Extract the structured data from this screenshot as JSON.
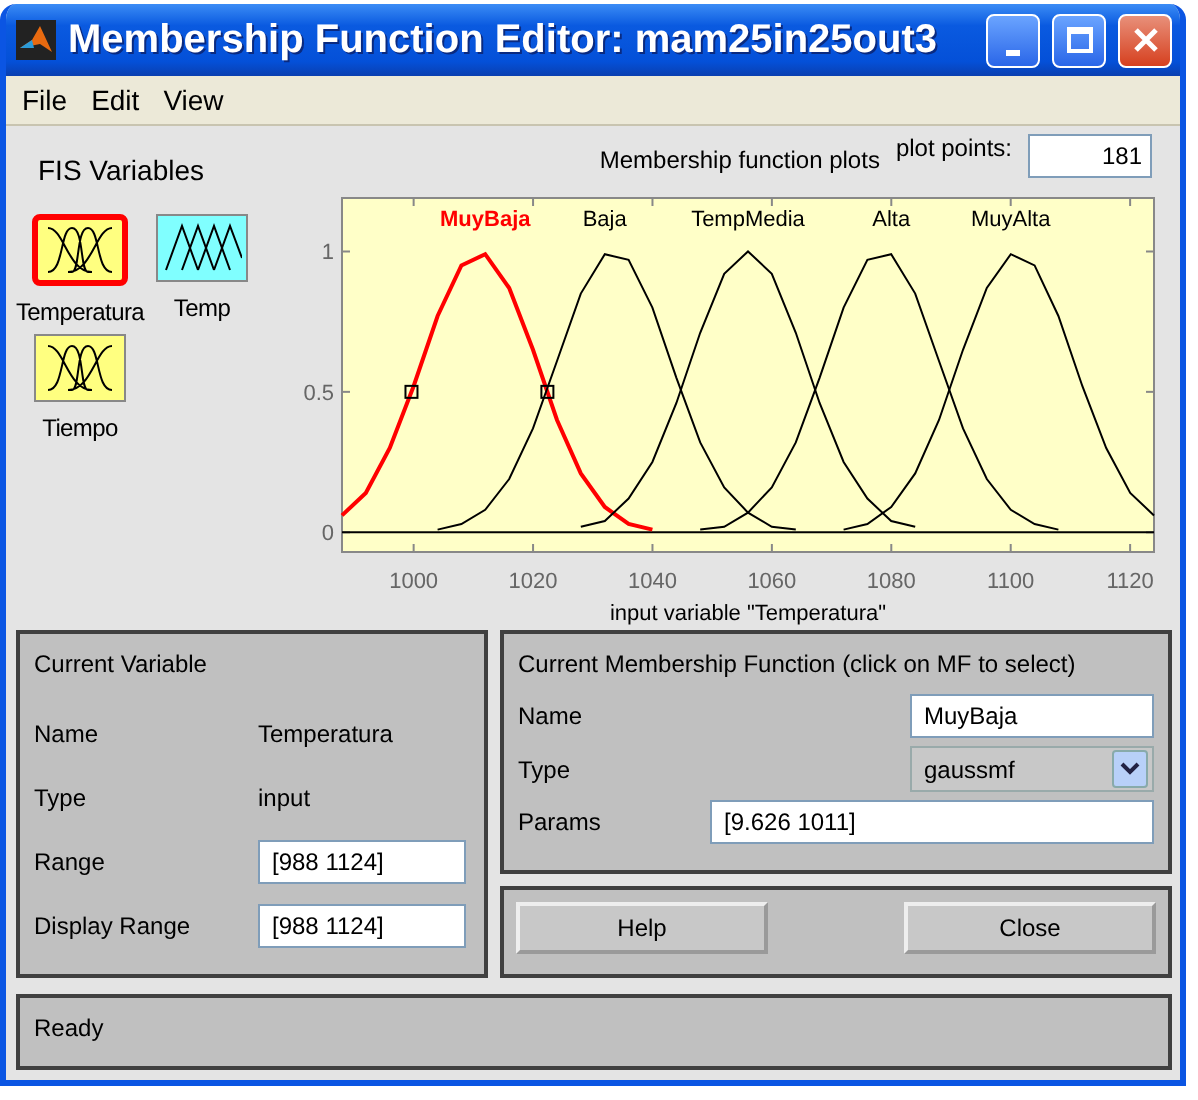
{
  "window": {
    "title": "Membership Function Editor: mam25in25out3"
  },
  "menu": [
    "File",
    "Edit",
    "View"
  ],
  "fis_variables": {
    "title": "FIS Variables",
    "items": [
      {
        "name": "Temperatura",
        "kind": "input",
        "color": "#ffff80",
        "selected": true
      },
      {
        "name": "Temp",
        "kind": "output",
        "color": "#80ffff",
        "selected": false
      },
      {
        "name": "Tiempo",
        "kind": "input",
        "color": "#ffff80",
        "selected": false
      }
    ]
  },
  "plot_header": {
    "title": "Membership function plots",
    "plot_points_label": "plot points:",
    "plot_points": "181"
  },
  "chart_data": {
    "type": "line",
    "xlabel": "input variable \"Temperatura\"",
    "xlim": [
      988,
      1124
    ],
    "ylim": [
      -0.07,
      1.19
    ],
    "xticks": [
      1000,
      1020,
      1040,
      1060,
      1080,
      1100,
      1120
    ],
    "yticks": [
      0,
      0.5,
      1
    ],
    "x": [
      988,
      992,
      996,
      1000,
      1004,
      1008,
      1012,
      1016,
      1020,
      1024,
      1028,
      1032,
      1036,
      1040,
      1044,
      1048,
      1052,
      1056,
      1060,
      1064,
      1068,
      1072,
      1076,
      1080,
      1084,
      1088,
      1092,
      1096,
      1100,
      1104,
      1108,
      1112,
      1116,
      1120,
      1124
    ],
    "series": [
      {
        "name": "MuyBaja",
        "color": "#ff0000",
        "values": [
          0.06,
          0.14,
          0.3,
          0.52,
          0.77,
          0.95,
          0.99,
          0.87,
          0.65,
          0.4,
          0.21,
          0.09,
          0.03,
          0.01,
          null,
          null,
          null,
          null,
          null,
          null,
          null,
          null,
          null,
          null,
          null,
          null,
          null,
          null,
          null,
          null,
          null,
          null,
          null,
          null,
          null
        ]
      },
      {
        "name": "Baja",
        "color": "#000000",
        "values": [
          null,
          null,
          null,
          null,
          0.01,
          0.03,
          0.08,
          0.19,
          0.37,
          0.61,
          0.85,
          0.99,
          0.97,
          0.8,
          0.55,
          0.32,
          0.16,
          0.07,
          0.02,
          0.01,
          null,
          null,
          null,
          null,
          null,
          null,
          null,
          null,
          null,
          null,
          null,
          null,
          null,
          null,
          null
        ]
      },
      {
        "name": "TempMedia",
        "color": "#000000",
        "values": [
          null,
          null,
          null,
          null,
          null,
          null,
          null,
          null,
          null,
          null,
          0.02,
          0.04,
          0.12,
          0.25,
          0.46,
          0.71,
          0.92,
          1,
          0.92,
          0.71,
          0.46,
          0.25,
          0.12,
          0.04,
          0.02,
          null,
          null,
          null,
          null,
          null,
          null,
          null,
          null,
          null,
          null
        ]
      },
      {
        "name": "Alta",
        "color": "#000000",
        "values": [
          null,
          null,
          null,
          null,
          null,
          null,
          null,
          null,
          null,
          null,
          null,
          null,
          null,
          null,
          null,
          0.01,
          0.02,
          0.07,
          0.16,
          0.32,
          0.55,
          0.8,
          0.97,
          0.99,
          0.85,
          0.61,
          0.37,
          0.19,
          0.08,
          0.03,
          0.01,
          null,
          null,
          null,
          null
        ]
      },
      {
        "name": "MuyAlta",
        "color": "#000000",
        "values": [
          null,
          null,
          null,
          null,
          null,
          null,
          null,
          null,
          null,
          null,
          null,
          null,
          null,
          null,
          null,
          null,
          null,
          null,
          null,
          null,
          null,
          0.01,
          0.03,
          0.09,
          0.21,
          0.4,
          0.65,
          0.87,
          0.99,
          0.95,
          0.77,
          0.52,
          0.3,
          0.14,
          0.06
        ]
      }
    ]
  },
  "curve_selection": [
    {
      "selected": true
    },
    {
      "selected": false
    },
    {
      "selected": false
    },
    {
      "selected": false
    },
    {
      "selected": false
    }
  ],
  "current_variable": {
    "title": "Current Variable",
    "rows": [
      {
        "label": "Name",
        "value": "Temperatura",
        "kind": "text"
      },
      {
        "label": "Type",
        "value": "input",
        "kind": "text"
      },
      {
        "label": "Range",
        "value": "[988 1124]",
        "kind": "field"
      },
      {
        "label": "Display Range",
        "value": "[988 1124]",
        "kind": "field"
      }
    ]
  },
  "current_mf": {
    "title": "Current Membership Function (click on MF to select)",
    "name_label": "Name",
    "name": "MuyBaja",
    "type_label": "Type",
    "type": "gaussmf",
    "params_label": "Params",
    "params": "[9.626 1011]"
  },
  "buttons": [
    "Help",
    "Close"
  ],
  "status_bar": "Ready"
}
